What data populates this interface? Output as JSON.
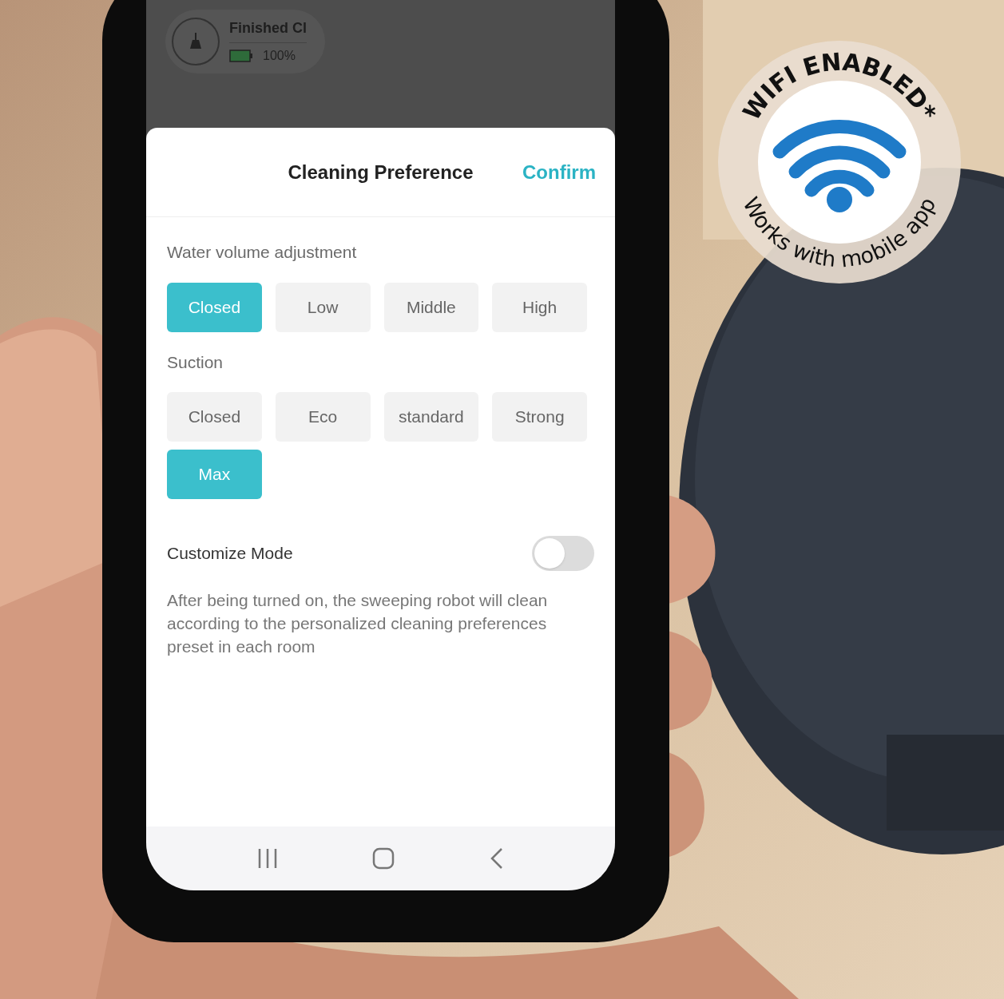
{
  "status_card": {
    "title": "Finished Cl",
    "battery": "100%"
  },
  "sheet": {
    "title": "Cleaning Preference",
    "confirm": "Confirm"
  },
  "sections": [
    {
      "label": "Water volume adjustment",
      "options": [
        {
          "label": "Closed",
          "selected": true
        },
        {
          "label": "Low",
          "selected": false
        },
        {
          "label": "Middle",
          "selected": false
        },
        {
          "label": "High",
          "selected": false
        }
      ]
    },
    {
      "label": "Suction",
      "options": [
        {
          "label": "Closed",
          "selected": false
        },
        {
          "label": "Eco",
          "selected": false
        },
        {
          "label": "standard",
          "selected": false
        },
        {
          "label": "Strong",
          "selected": false
        },
        {
          "label": "Max",
          "selected": true
        }
      ]
    }
  ],
  "customize": {
    "label": "Customize Mode",
    "on": false,
    "description": "After being turned on, the sweeping robot will clean according to the personalized cleaning preferences preset in each room"
  },
  "badge": {
    "top": "WIFI ENABLED*",
    "bottom": "Works with mobile app"
  }
}
